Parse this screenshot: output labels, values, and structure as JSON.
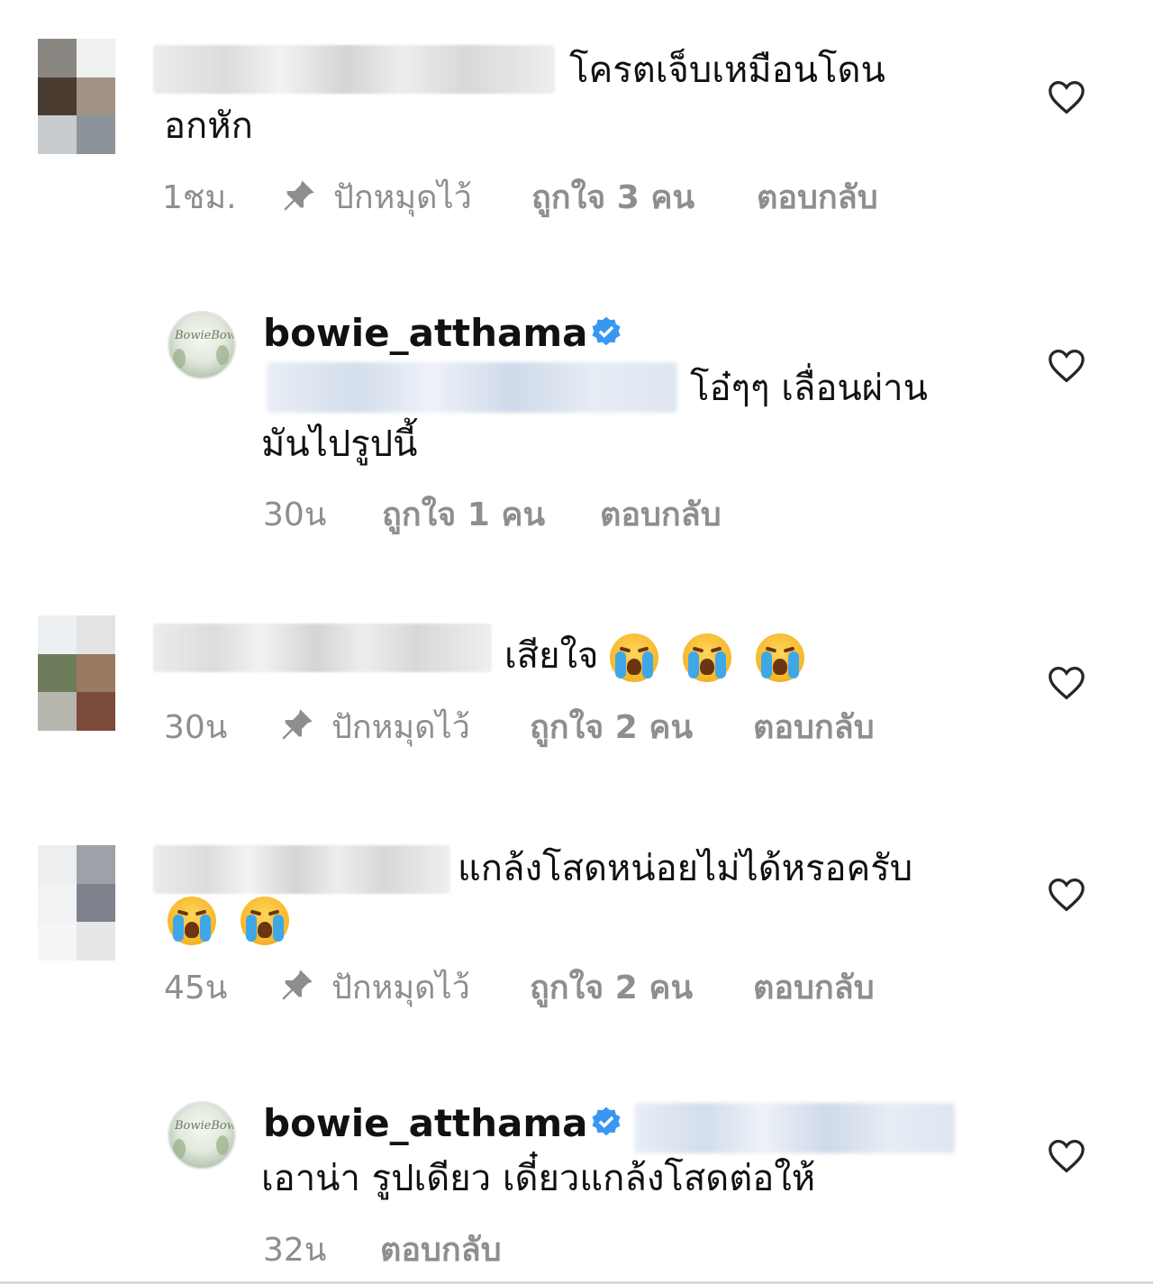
{
  "comments": [
    {
      "text_line1": "โครตเจ็บเหมือนโดน",
      "text_line2": "อกหัก",
      "time": "1ชม.",
      "pin_label": "ปักหมุดไว้",
      "likes": "ถูกใจ 3 คน",
      "reply_label": "ตอบกลับ"
    },
    {
      "username": "bowie_atthama",
      "avatar_text": "BowieBowie",
      "text_line1": "โอ๋ๆๆ เลื่อนผ่าน",
      "text_line2": "มันไปรูปนี้",
      "time": "30น",
      "likes": "ถูกใจ 1 คน",
      "reply_label": "ตอบกลับ"
    },
    {
      "text_line1": "เสียใจ",
      "time": "30น",
      "pin_label": "ปักหมุดไว้",
      "likes": "ถูกใจ 2 คน",
      "reply_label": "ตอบกลับ"
    },
    {
      "text_line1": "แกล้งโสดหน่อยไม่ได้หรอครับ",
      "time": "45น",
      "pin_label": "ปักหมุดไว้",
      "likes": "ถูกใจ 2 คน",
      "reply_label": "ตอบกลับ"
    },
    {
      "username": "bowie_atthama",
      "avatar_text": "BowieBowie",
      "text_line1": "เอาน่า รูปเดียว เดี๋ยวแกล้งโสดต่อให้",
      "time": "32น",
      "reply_label": "ตอบกลับ"
    }
  ],
  "icons": {
    "heart": "heart-outline-icon",
    "pin": "pin-icon",
    "verified": "verified-badge-icon",
    "emoji": "loudly-crying-face-emoji"
  },
  "colors": {
    "meta_gray": "#8e8e8e",
    "verified_blue": "#3897f0",
    "text": "#111111"
  }
}
